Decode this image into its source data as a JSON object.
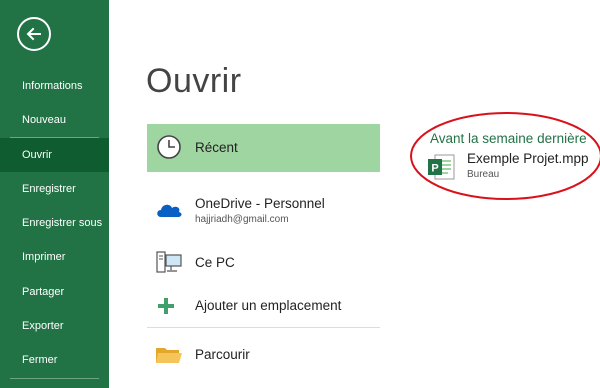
{
  "sidebar": {
    "back_icon": "back-arrow-icon",
    "items": [
      {
        "label": "Informations",
        "active": false
      },
      {
        "label": "Nouveau",
        "active": false
      },
      {
        "label": "Ouvrir",
        "active": true
      },
      {
        "label": "Enregistrer",
        "active": false
      },
      {
        "label": "Enregistrer sous",
        "active": false
      },
      {
        "label": "Imprimer",
        "active": false
      },
      {
        "label": "Partager",
        "active": false
      },
      {
        "label": "Exporter",
        "active": false
      },
      {
        "label": "Fermer",
        "active": false
      }
    ]
  },
  "main": {
    "title": "Ouvrir",
    "places": {
      "recent": {
        "label": "Récent",
        "icon": "clock-icon"
      },
      "onedrive": {
        "label": "OneDrive - Personnel",
        "email": "hajjriadh@gmail.com",
        "icon": "cloud-icon"
      },
      "thispc": {
        "label": "Ce PC",
        "icon": "computer-icon"
      },
      "addplace": {
        "label": "Ajouter un emplacement",
        "icon": "plus-icon"
      },
      "browse": {
        "label": "Parcourir",
        "icon": "folder-icon"
      }
    }
  },
  "recent_files": {
    "group_label": "Avant la semaine dernière",
    "items": [
      {
        "name": "Exemple Projet.mpp",
        "location": "Bureau",
        "icon": "project-file-icon"
      }
    ]
  },
  "colors": {
    "sidebar_bg": "#217346",
    "sidebar_active": "#0e5c2f",
    "recent_highlight": "#9fd5a1",
    "group_label": "#217346",
    "annotation_ellipse": "#d9111b"
  }
}
